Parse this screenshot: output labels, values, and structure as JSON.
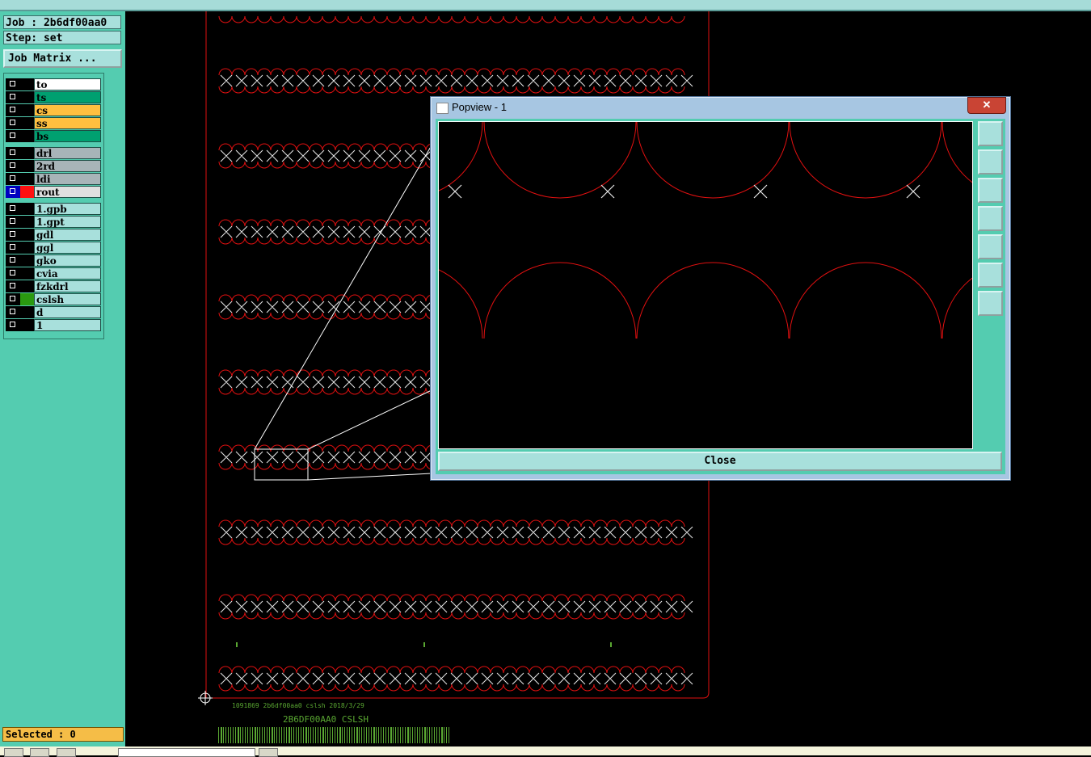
{
  "job_label": "Job : 2b6df00aa0",
  "step_label": "Step: set",
  "job_matrix_button": "Job Matrix ...",
  "layers": [
    {
      "name": "to",
      "color": "#ffffff"
    },
    {
      "name": "ts",
      "color": "#00a070"
    },
    {
      "name": "cs",
      "color": "#ffbf40"
    },
    {
      "name": "ss",
      "color": "#ffbf40"
    },
    {
      "name": "bs",
      "color": "#00a070"
    },
    {
      "name": "drl",
      "color": "#a8b4b8"
    },
    {
      "name": "2rd",
      "color": "#a8b4b8"
    },
    {
      "name": "ldi",
      "color": "#a8b4b8"
    },
    {
      "name": "rout",
      "color": "#e0e0e0",
      "active": true,
      "swatch": "#ff1010"
    },
    {
      "name": "1.gpb",
      "color": "#a8e0dc"
    },
    {
      "name": "1.gpt",
      "color": "#a8e0dc"
    },
    {
      "name": "gdl",
      "color": "#a8e0dc"
    },
    {
      "name": "ggl",
      "color": "#a8e0dc"
    },
    {
      "name": "gko",
      "color": "#a8e0dc"
    },
    {
      "name": "cvia",
      "color": "#a8e0dc"
    },
    {
      "name": "fzkdrl",
      "color": "#a8e0dc"
    },
    {
      "name": "cslsh",
      "color": "#a8e0dc",
      "swatch": "#2a9a10"
    },
    {
      "name": "d",
      "color": "#a8e0dc"
    },
    {
      "name": "1",
      "color": "#a8e0dc"
    }
  ],
  "selected_label": "Selected : 0",
  "board_text_small": "1091869 2b6df00aa0 cslsh 2018/3/29",
  "board_text_large": "2B6DF00AA0 CSLSH",
  "popup": {
    "title": "Popview - 1",
    "close_x": "✕",
    "close_button": "Close",
    "tools": [
      "zoom-window-icon",
      "pan-up-icon",
      "pan-down-icon",
      "pan-left-icon",
      "pan-right-icon",
      "zoom-in-icon",
      "zoom-out-icon"
    ]
  },
  "colors": {
    "route": "#e01010",
    "panel": "#54ccb0",
    "box": "#a8e0dc",
    "highlight": "#f5bd47"
  }
}
